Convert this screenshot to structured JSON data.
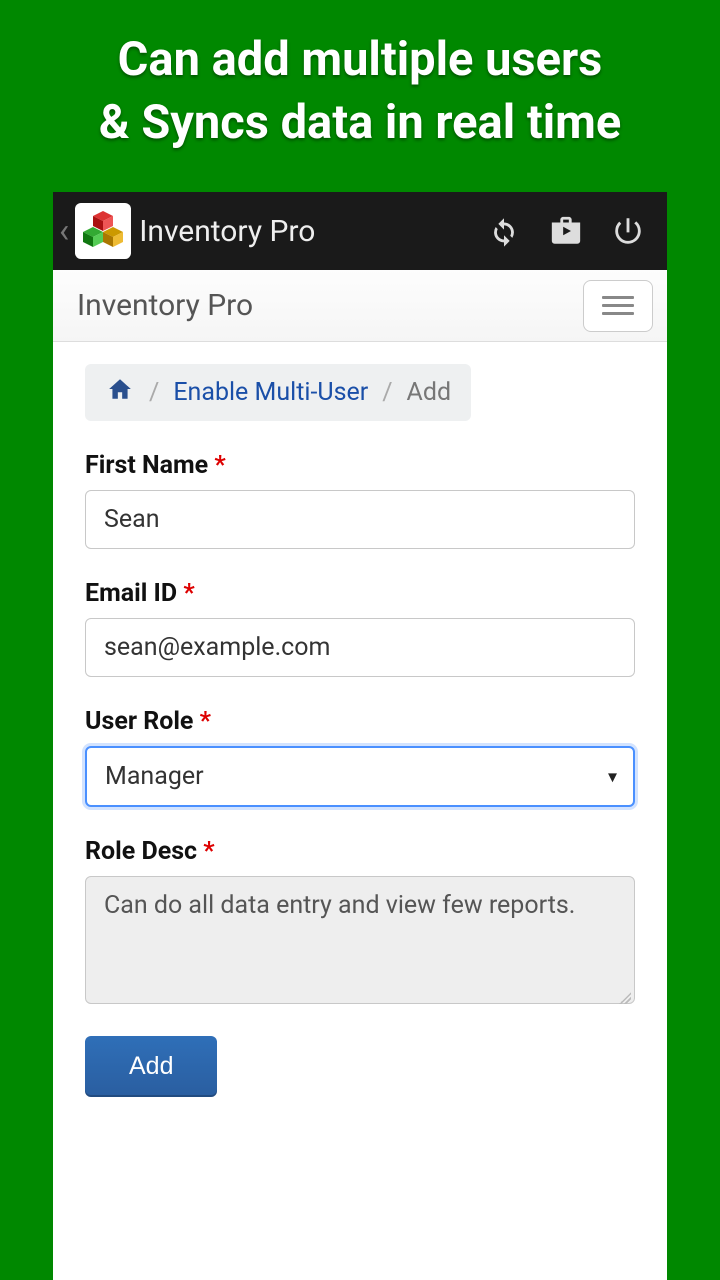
{
  "promo": {
    "line1": "Can add multiple users",
    "line2": "& Syncs data in real time"
  },
  "appbar": {
    "title": "Inventory Pro"
  },
  "navbar": {
    "title": "Inventory Pro"
  },
  "breadcrumb": {
    "link": "Enable Multi-User",
    "current": "Add"
  },
  "form": {
    "first_name": {
      "label": "First Name",
      "value": "Sean"
    },
    "email": {
      "label": "Email ID",
      "value": "sean@example.com"
    },
    "role": {
      "label": "User Role",
      "value": "Manager"
    },
    "role_desc": {
      "label": "Role Desc",
      "value": "Can do all data entry and view few reports."
    },
    "submit_label": "Add"
  }
}
